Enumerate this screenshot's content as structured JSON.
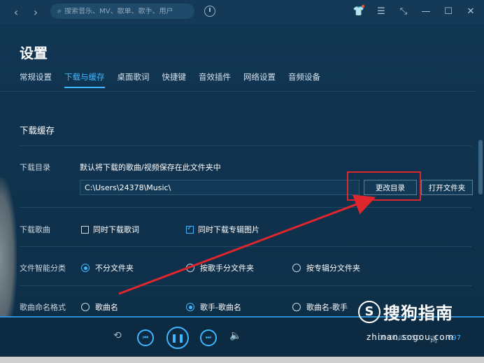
{
  "titlebar": {
    "back_icon": "chevron-left-icon",
    "forward_icon": "chevron-right-icon",
    "search_placeholder": "搜索音乐、MV、歌单、歌手、用户",
    "window_icons": [
      "shirt-icon",
      "menu-icon",
      "mini-mode-icon",
      "minimize-icon",
      "maximize-icon",
      "close-icon"
    ]
  },
  "settings": {
    "title": "设置",
    "tabs": [
      {
        "label": "常规设置"
      },
      {
        "label": "下载与缓存",
        "active": true
      },
      {
        "label": "桌面歌词"
      },
      {
        "label": "快捷键"
      },
      {
        "label": "音效插件"
      },
      {
        "label": "网络设置"
      },
      {
        "label": "音频设备"
      }
    ],
    "section_title": "下载缓存",
    "download_dir": {
      "label": "下载目录",
      "description": "默认将下载的歌曲/视频保存在此文件夹中",
      "path": "C:\\Users\\24378\\Music\\",
      "change_button": "更改目录",
      "open_button": "打开文件夹"
    },
    "download_song": {
      "label": "下载歌曲",
      "option1": "同时下载歌词",
      "option1_checked": false,
      "option2": "同时下载专辑图片",
      "option2_checked": true
    },
    "smart_category": {
      "label": "文件智能分类",
      "options": [
        "不分文件夹",
        "按歌手分文件夹",
        "按专辑分文件夹"
      ],
      "selected": 0
    },
    "naming_format": {
      "label": "歌曲命名格式",
      "options": [
        "歌曲名",
        "歌手-歌曲名",
        "歌曲名-歌手"
      ],
      "selected": 1
    }
  },
  "player": {
    "time": "00:00/03:50",
    "lyric_label": "词",
    "playlist_count": "697"
  },
  "watermark": {
    "logo_text": "S",
    "brand": "搜狗指南",
    "url": "zhinan.sogou.com"
  },
  "colors": {
    "accent": "#3fb6ff",
    "highlight": "#e0262d",
    "background": "#0f2d44"
  }
}
